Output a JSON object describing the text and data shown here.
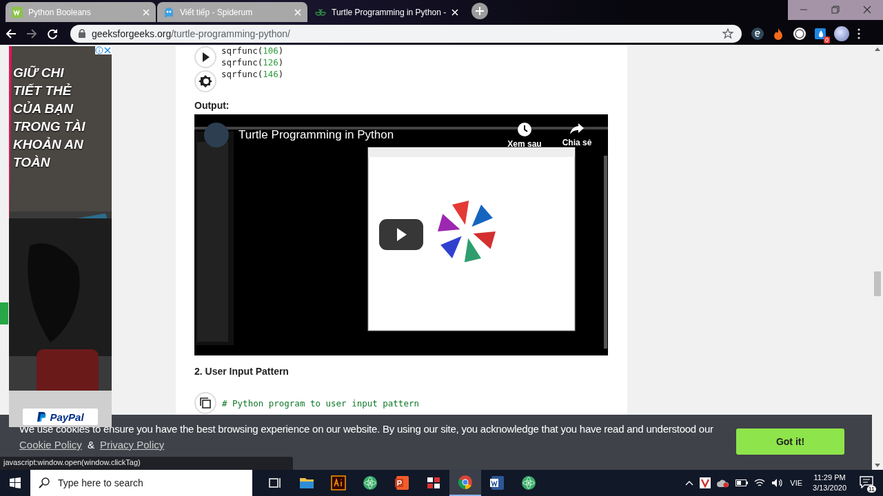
{
  "browser": {
    "tabs": [
      {
        "title": "Python Booleans",
        "selected": false
      },
      {
        "title": "Viết tiếp - Spiderum",
        "selected": false
      },
      {
        "title": "Turtle Programming in Python -",
        "selected": true
      }
    ],
    "url": {
      "domain": "geeksforgeeks.org",
      "path": "/turtle-programming-python/"
    },
    "extension_badge": "0"
  },
  "ad": {
    "headline": "GIỮ CHI TIẾT THẺ CỦA BẠN TRONG TÀI KHOẢN AN TOÀN",
    "brand": "PayPal"
  },
  "article": {
    "code_lines": [
      {
        "parts": [
          {
            "kind": "plain",
            "text": "sqrfunc("
          },
          {
            "kind": "number",
            "text": "106"
          },
          {
            "kind": "plain",
            "text": ")"
          }
        ]
      },
      {
        "parts": [
          {
            "kind": "plain",
            "text": "sqrfunc("
          },
          {
            "kind": "number",
            "text": "126"
          },
          {
            "kind": "plain",
            "text": ")"
          }
        ]
      },
      {
        "parts": [
          {
            "kind": "plain",
            "text": "sqrfunc("
          },
          {
            "kind": "number",
            "text": "146"
          },
          {
            "kind": "plain",
            "text": ")"
          }
        ]
      }
    ],
    "output_label": "Output:",
    "video": {
      "title": "Turtle Programming in Python",
      "actions": [
        {
          "kind": "clock",
          "label": "Xem sau"
        },
        {
          "kind": "share",
          "label": "Chia sẻ"
        }
      ]
    },
    "section_heading": "2. User Input Pattern",
    "code_comment": "# Python program to user input pattern"
  },
  "cookie_bar": {
    "message": "We use cookies to ensure you have the best browsing experience on our website. By using our site, you acknowledge that you have read and understood our",
    "links": [
      "Cookie Policy",
      "Privacy Policy"
    ],
    "separator": "&",
    "button": "Got it!"
  },
  "status_tip": "javascript:window.open(window.clickTag)",
  "taskbar": {
    "search_placeholder": "Type here to search",
    "apps": [
      {
        "kind": "taskview",
        "selected": false
      },
      {
        "kind": "folder",
        "selected": false
      },
      {
        "kind": "illustrator",
        "selected": false
      },
      {
        "kind": "atom",
        "selected": false
      },
      {
        "kind": "powerpoint",
        "selected": false
      },
      {
        "kind": "grid",
        "selected": false
      },
      {
        "kind": "chrome",
        "selected": true
      },
      {
        "kind": "word",
        "selected": false
      },
      {
        "kind": "atom",
        "selected": false
      }
    ],
    "language": "VIE",
    "time": "11:29 PM",
    "date": "3/13/2020",
    "notifications": "11"
  }
}
